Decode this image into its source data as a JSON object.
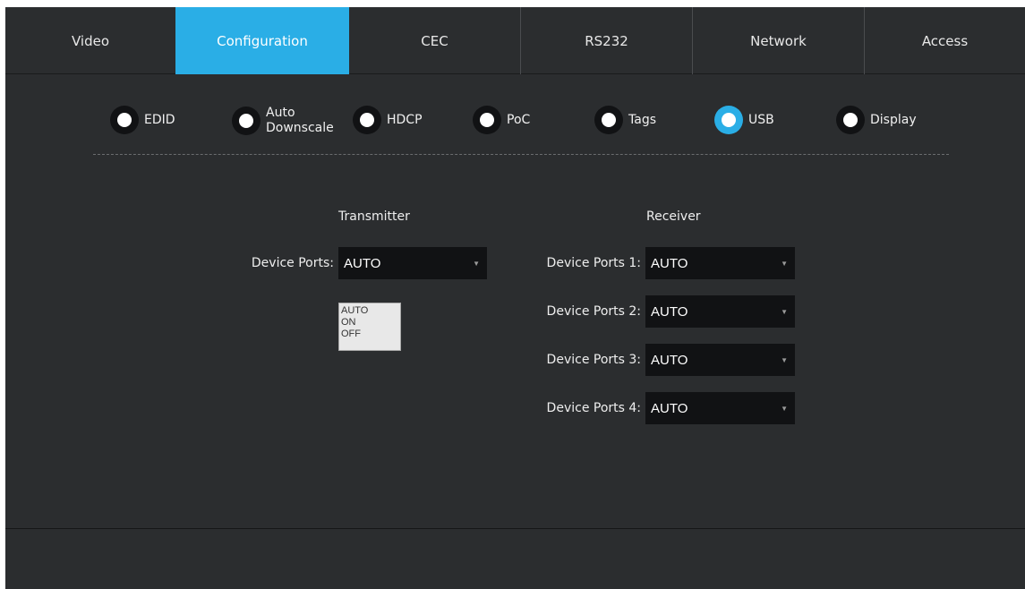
{
  "tabs": [
    {
      "label": "Video",
      "active": false
    },
    {
      "label": "Configuration",
      "active": true
    },
    {
      "label": "CEC",
      "active": false
    },
    {
      "label": "RS232",
      "active": false
    },
    {
      "label": "Network",
      "active": false
    },
    {
      "label": "Access",
      "active": false
    }
  ],
  "options": [
    {
      "label": "EDID",
      "selected": false
    },
    {
      "label": "Auto Downscale",
      "line1": "Auto",
      "line2": "Downscale",
      "selected": false
    },
    {
      "label": "HDCP",
      "selected": false
    },
    {
      "label": "PoC",
      "selected": false
    },
    {
      "label": "Tags",
      "selected": false
    },
    {
      "label": "USB",
      "selected": true
    },
    {
      "label": "Display",
      "selected": false
    }
  ],
  "transmitter": {
    "heading": "Transmitter",
    "field_label": "Device Ports:",
    "value": "AUTO",
    "dropdown_options": [
      "AUTO",
      "ON",
      "OFF"
    ]
  },
  "receiver": {
    "heading": "Receiver",
    "ports": [
      {
        "label": "Device Ports 1:",
        "value": "AUTO"
      },
      {
        "label": "Device Ports 2:",
        "value": "AUTO"
      },
      {
        "label": "Device Ports 3:",
        "value": "AUTO"
      },
      {
        "label": "Device Ports 4:",
        "value": "AUTO"
      }
    ]
  },
  "colors": {
    "accent": "#2aaee6",
    "background": "#2b2d2f",
    "control": "#111214"
  }
}
